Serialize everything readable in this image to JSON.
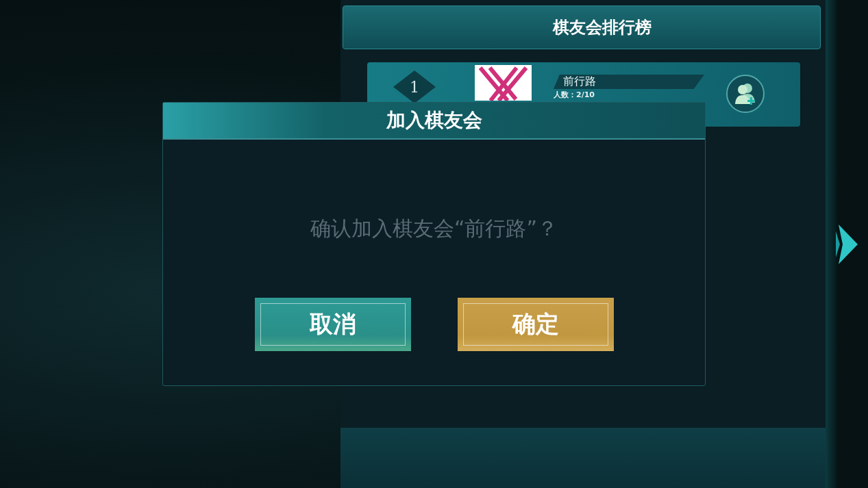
{
  "ranking_panel": {
    "title": "棋友会排行榜",
    "clubs": [
      {
        "rank": "1",
        "name": "前行路",
        "members": "人数：2/10"
      }
    ]
  },
  "dialog": {
    "title": "加入棋友会",
    "message": "确认加入棋友会“前行路”？",
    "buttons": [
      {
        "label": "取消",
        "kind": "cancel"
      },
      {
        "label": "确定",
        "kind": "confirm"
      }
    ]
  }
}
